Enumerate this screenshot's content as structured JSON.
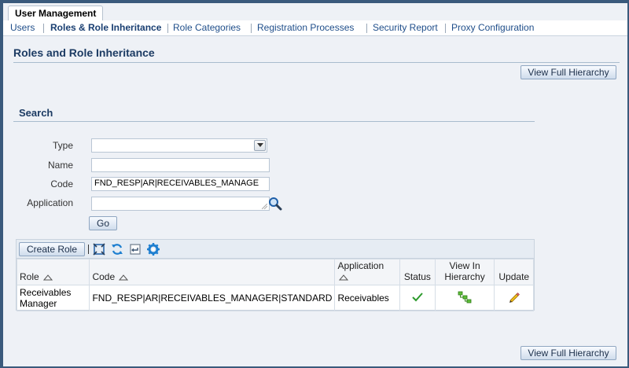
{
  "header": {
    "app_tab": "User Management"
  },
  "subnav": {
    "items": [
      {
        "label": "Users"
      },
      {
        "label": "Roles & Role Inheritance"
      },
      {
        "label": "Role Categories"
      },
      {
        "label": "Registration Processes"
      },
      {
        "label": "Security Report"
      },
      {
        "label": "Proxy Configuration"
      }
    ],
    "active_index": 1
  },
  "page": {
    "title": "Roles and Role Inheritance",
    "view_hierarchy_label": "View Full Hierarchy"
  },
  "search": {
    "title": "Search",
    "type_label": "Type",
    "type_value": "",
    "name_label": "Name",
    "name_value": "",
    "code_label": "Code",
    "code_value": "FND_RESP|AR|RECEIVABLES_MANAGE",
    "application_label": "Application",
    "application_value": "",
    "go_label": "Go"
  },
  "results": {
    "create_role_label": "Create Role",
    "columns": [
      "Role",
      "Code",
      "Application",
      "Status",
      "View In Hierarchy",
      "Update"
    ],
    "rows": [
      {
        "role": "Receivables Manager",
        "code": "FND_RESP|AR|RECEIVABLES_MANAGER|STANDARD",
        "application": "Receivables",
        "status_icon": "checkmark-icon",
        "hierarchy_icon": "hierarchy-icon",
        "update_icon": "pencil-icon"
      }
    ]
  },
  "footer": {
    "view_hierarchy_label": "View Full Hierarchy"
  },
  "colors": {
    "frame_border": "#3a5a7c",
    "background": "#eef1f6",
    "link": "#1f4e8a",
    "title": "#1c3b63"
  }
}
